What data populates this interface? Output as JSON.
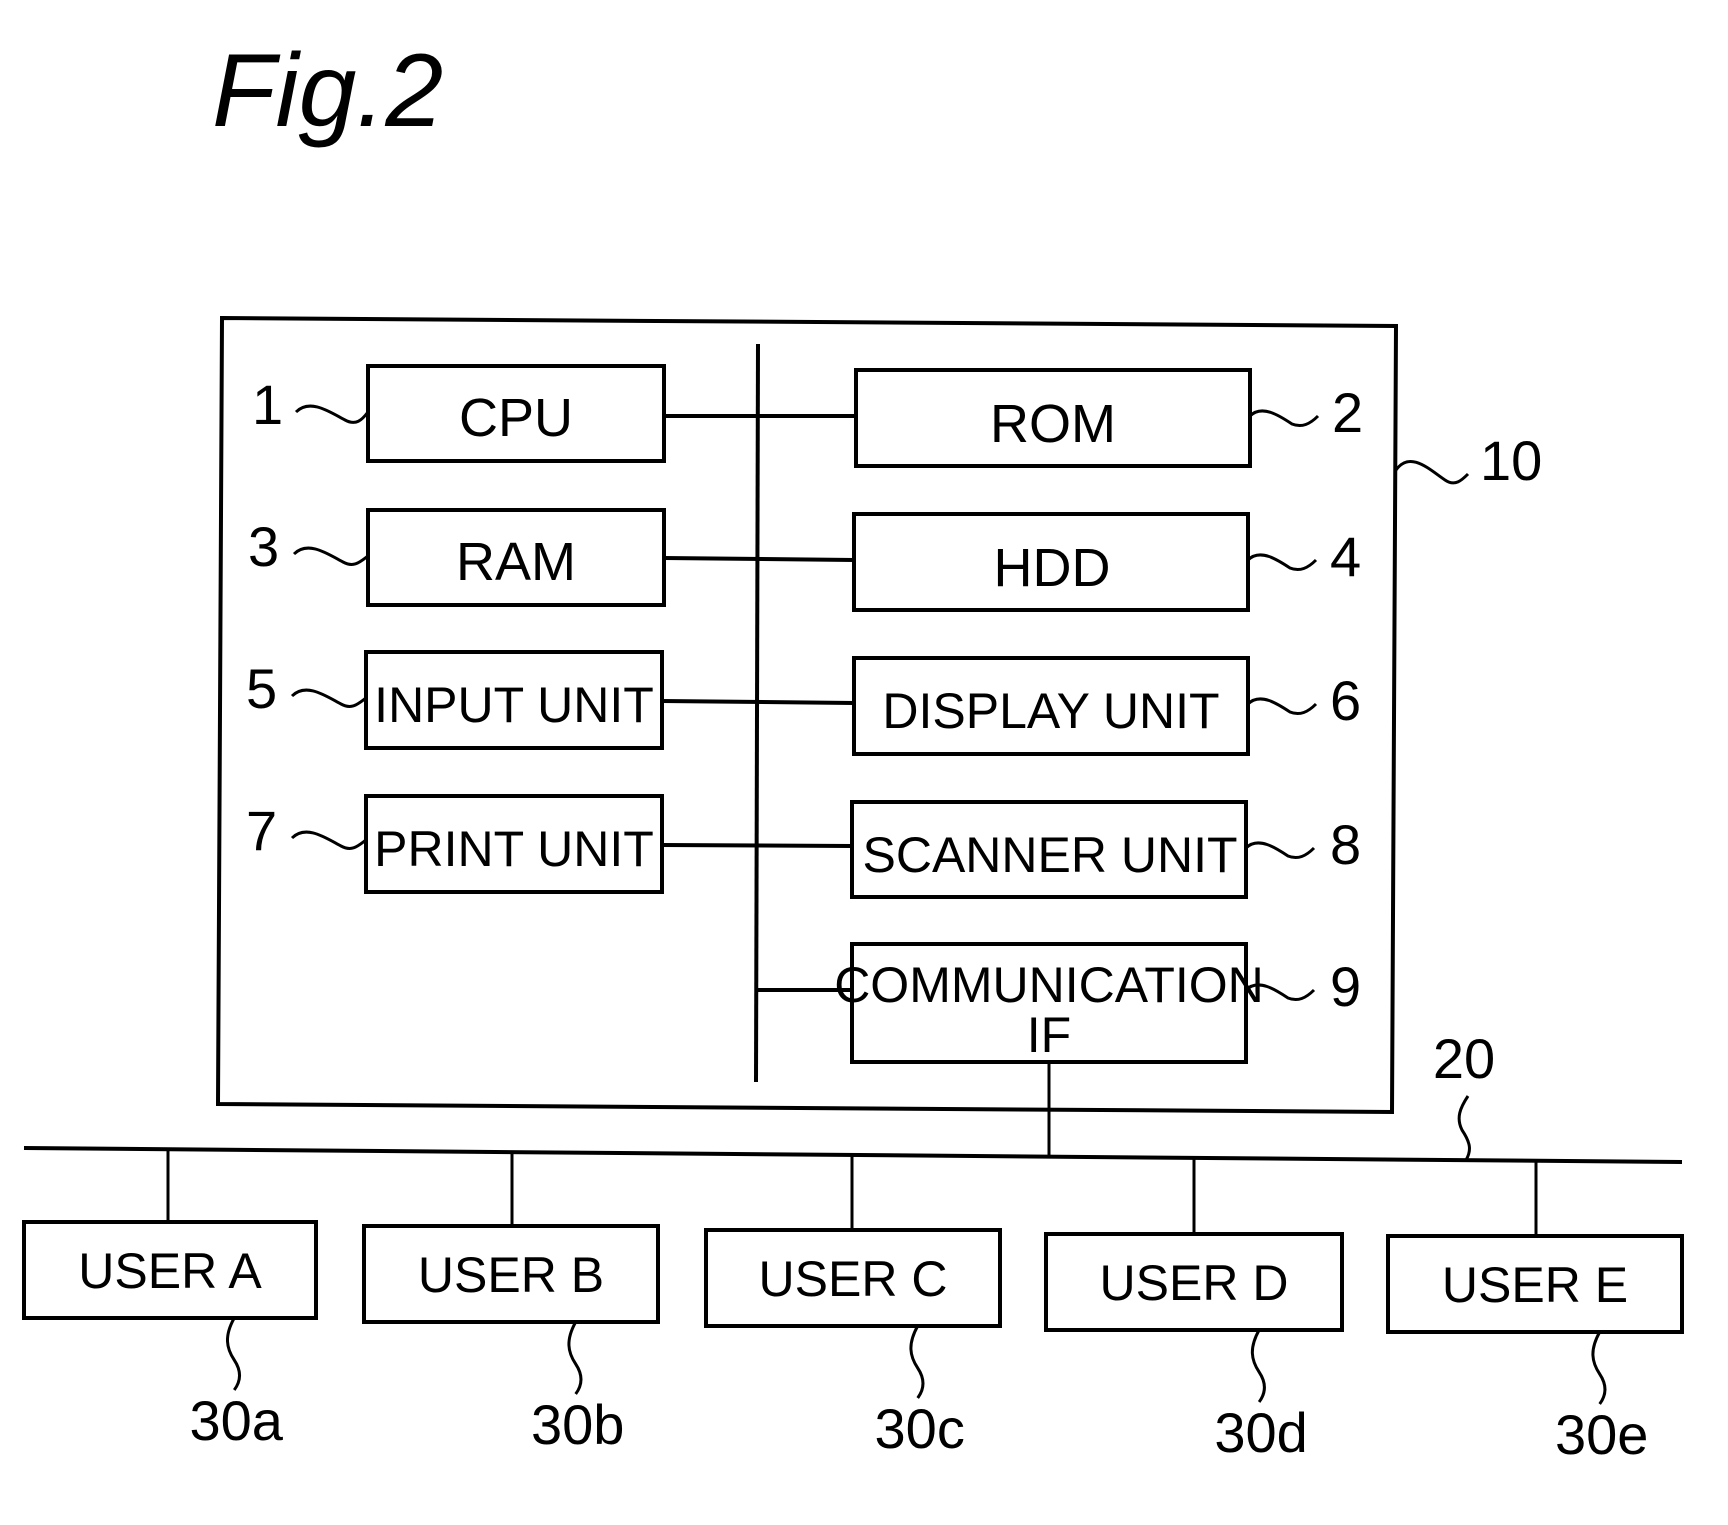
{
  "figure": {
    "title": "Fig.2"
  },
  "device": {
    "ref": "10",
    "components": [
      {
        "id": "cpu",
        "label": "CPU",
        "ref": "1"
      },
      {
        "id": "rom",
        "label": "ROM",
        "ref": "2"
      },
      {
        "id": "ram",
        "label": "RAM",
        "ref": "3"
      },
      {
        "id": "hdd",
        "label": "HDD",
        "ref": "4"
      },
      {
        "id": "input",
        "label": "INPUT  UNIT",
        "ref": "5"
      },
      {
        "id": "display",
        "label": "DISPLAY  UNIT",
        "ref": "6"
      },
      {
        "id": "print",
        "label": "PRINT  UNIT",
        "ref": "7"
      },
      {
        "id": "scanner",
        "label": "SCANNER  UNIT",
        "ref": "8"
      },
      {
        "id": "comm",
        "label_line1": "COMMUNICATION",
        "label_line2": "IF",
        "ref": "9"
      }
    ]
  },
  "network": {
    "ref": "20"
  },
  "users": [
    {
      "label": "USER  A",
      "ref": "30a"
    },
    {
      "label": "USER  B",
      "ref": "30b"
    },
    {
      "label": "USER  C",
      "ref": "30c"
    },
    {
      "label": "USER  D",
      "ref": "30d"
    },
    {
      "label": "USER  E",
      "ref": "30e"
    }
  ]
}
